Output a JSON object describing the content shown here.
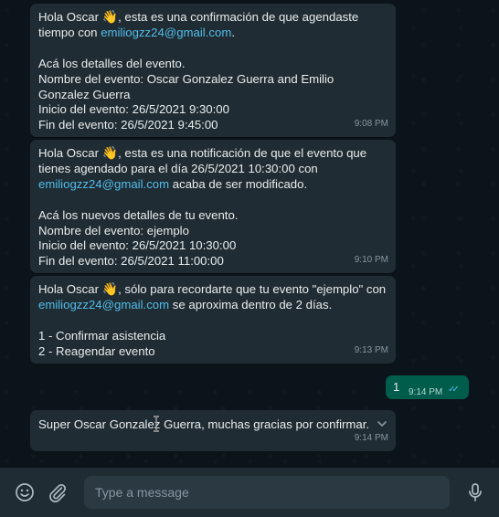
{
  "messages": [
    {
      "greeting": "Hola Oscar ",
      "emoji": "👋",
      "text1": ", esta es una confirmación de que agendaste tiempo con ",
      "email": "emiliogzz24@gmail.com",
      "text2": ".\n\nAcá los detalles del evento.\nNombre del evento: Oscar Gonzalez Guerra and Emilio Gonzalez Guerra\nInicio del evento: 26/5/2021 9:30:00\nFin del evento: 26/5/2021 9:45:00",
      "time": "9:08 PM"
    },
    {
      "greeting": "Hola Oscar ",
      "emoji": "👋",
      "text1": ", esta es una notificación de que el evento que tienes agendado para el día 26/5/2021 10:30:00 con ",
      "email": "emiliogzz24@gmail.com",
      "text2": " acaba de ser modificado.\n\nAcá los nuevos detalles de tu evento.\nNombre del evento: ejemplo\nInicio del evento: 26/5/2021 10:30:00\nFin del evento: 26/5/2021 11:00:00",
      "time": "9:10 PM"
    },
    {
      "greeting": "Hola Oscar ",
      "emoji": "👋",
      "text1": ", sólo para recordarte que tu evento \"ejemplo\" con ",
      "email": "emiliogzz24@gmail.com",
      "text2": " se aproxima dentro de 2 días.\n\n1 - Confirmar asistencia\n2 - Reagendar evento",
      "time": "9:13 PM"
    }
  ],
  "outgoing": {
    "text": "1",
    "time": "9:14 PM",
    "status": "✓✓"
  },
  "reply": {
    "text": "Super Oscar Gonzalez Guerra, muchas gracias por confirmar.",
    "time": "9:14 PM"
  },
  "composer": {
    "placeholder": "Type a message"
  },
  "icons": {
    "emoji": "emoji-icon",
    "attach": "paperclip-icon",
    "mic": "microphone-icon",
    "menu": "chevron-down-icon"
  },
  "colors": {
    "background": "#0b141a",
    "incoming_bubble": "#1f2c33",
    "outgoing_bubble": "#005c4b",
    "link": "#53bdeb",
    "read_ticks": "#53bdeb"
  }
}
